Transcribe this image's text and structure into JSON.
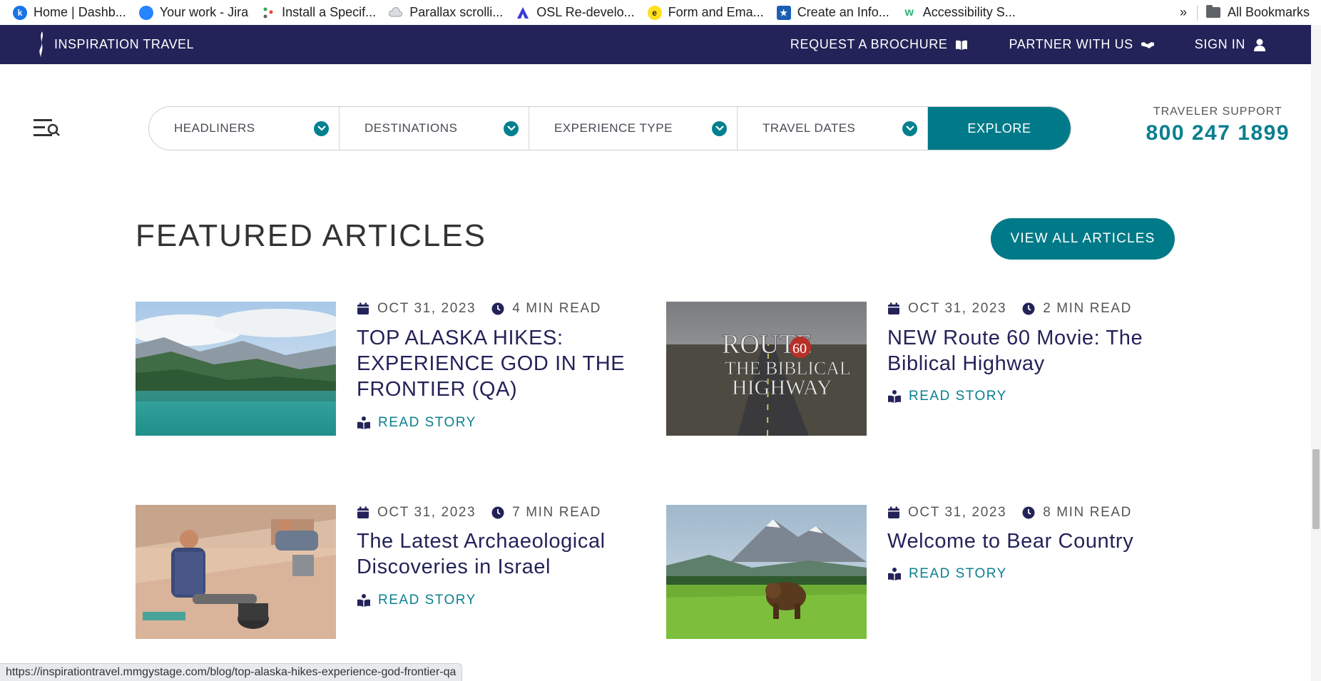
{
  "bookmarks": {
    "items": [
      {
        "label": "Home | Dashb...",
        "icon": "k-circle-icon",
        "color": "#1a73e8"
      },
      {
        "label": "Your work - Jira",
        "icon": "blue-circle-icon",
        "color": "#2684ff"
      },
      {
        "label": "Install a Specif...",
        "icon": "dots-icon",
        "color": "#34a853"
      },
      {
        "label": "Parallax scrolli...",
        "icon": "cloud-icon",
        "color": "#9aa0a6"
      },
      {
        "label": "OSL Re-develo...",
        "icon": "triangle-icon",
        "color": "#3b3bd6"
      },
      {
        "label": "Form and Ema...",
        "icon": "mailchimp-icon",
        "color": "#ffe01b"
      },
      {
        "label": "Create an Info...",
        "icon": "star-badge-icon",
        "color": "#1a5fb4"
      },
      {
        "label": "Accessibility S...",
        "icon": "w-icon",
        "color": "#2bb673"
      }
    ],
    "overflow": "»",
    "all_bookmarks": "All Bookmarks"
  },
  "header": {
    "brand": "INSPIRATION TRAVEL",
    "links": {
      "brochure": "REQUEST A BROCHURE",
      "partner": "PARTNER WITH US",
      "signin": "SIGN IN"
    },
    "bg_color": "#232359"
  },
  "search": {
    "headliners": "HEADLINERS",
    "destinations": "DESTINATIONS",
    "experience": "EXPERIENCE TYPE",
    "dates": "TRAVEL DATES",
    "explore": "EXPLORE",
    "accent": "#007a88"
  },
  "support": {
    "label": "TRAVELER SUPPORT",
    "phone": "800 247 1899"
  },
  "featured": {
    "title": "FEATURED ARTICLES",
    "view_all": "VIEW ALL ARTICLES",
    "read_story": "READ STORY",
    "articles": [
      {
        "date": "OCT 31, 2023",
        "read_time": "4 MIN READ",
        "title_lines": [
          "TOP ALASKA HIKES:",
          "EXPERIENCE GOD IN THE",
          "FRONTIER (QA)"
        ],
        "image": "alaska-lake-mountains"
      },
      {
        "date": "OCT 31, 2023",
        "read_time": "2 MIN READ",
        "title_lines": [
          "NEW Route 60 Movie: The",
          "Biblical Highway"
        ],
        "image": "route-60-highway"
      },
      {
        "date": "OCT 31, 2023",
        "read_time": "7 MIN READ",
        "title_lines": [
          "The Latest Archaeological",
          "Discoveries in Israel"
        ],
        "image": "archaeology-dig"
      },
      {
        "date": "OCT 31, 2023",
        "read_time": "8 MIN READ",
        "title_lines": [
          "Welcome to Bear Country"
        ],
        "image": "bear-meadow"
      }
    ]
  },
  "route60_thumb": {
    "line1": "ROUTE",
    "number": "60",
    "line2": "THE BIBLICAL",
    "line3": "HIGHWAY"
  },
  "statusbar": {
    "url": "https://inspirationtravel.mmgystage.com/blog/top-alaska-hikes-experience-god-frontier-qa"
  }
}
